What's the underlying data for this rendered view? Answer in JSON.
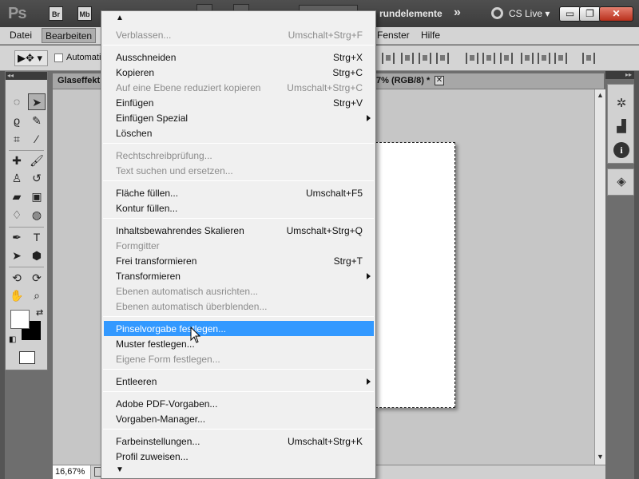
{
  "app": {
    "logo": "Ps",
    "bridge_button": "Br",
    "minibridge_button": "Mb",
    "workspace_label": "rundelemente",
    "workspace_more": "»",
    "cs_live_label": "CS Live",
    "minimize_label": "▭",
    "restore_label": "❐",
    "close_label": "✕"
  },
  "menubar": {
    "items": [
      "Datei",
      "Bearbeiten",
      "Fenster",
      "Hilfe"
    ]
  },
  "options_bar": {
    "tool_label": "▶✥ ▾",
    "auto_select_label": "Automatis"
  },
  "document": {
    "tab_left_title": "Glaseffekt",
    "tab_right_title": "7% (RGB/8) *",
    "tab_close_label": "✕",
    "zoom_value": "16,67%"
  },
  "edit_menu": {
    "items": [
      {
        "label": "Verblassen...",
        "shortcut": "Umschalt+Strg+F",
        "enabled": false
      },
      {
        "label": "Ausschneiden",
        "shortcut": "Strg+X",
        "enabled": true
      },
      {
        "label": "Kopieren",
        "shortcut": "Strg+C",
        "enabled": true
      },
      {
        "label": "Auf eine Ebene reduziert kopieren",
        "shortcut": "Umschalt+Strg+C",
        "enabled": false
      },
      {
        "label": "Einfügen",
        "shortcut": "Strg+V",
        "enabled": true
      },
      {
        "label": "Einfügen Spezial",
        "shortcut": "",
        "enabled": true
      },
      {
        "label": "Löschen",
        "shortcut": "",
        "enabled": true
      },
      {
        "label": "Rechtschreibprüfung...",
        "shortcut": "",
        "enabled": false
      },
      {
        "label": "Text suchen und ersetzen...",
        "shortcut": "",
        "enabled": false
      },
      {
        "label": "Fläche füllen...",
        "shortcut": "Umschalt+F5",
        "enabled": true
      },
      {
        "label": "Kontur füllen...",
        "shortcut": "",
        "enabled": true
      },
      {
        "label": "Inhaltsbewahrendes Skalieren",
        "shortcut": "Umschalt+Strg+Q",
        "enabled": true
      },
      {
        "label": "Formgitter",
        "shortcut": "",
        "enabled": false
      },
      {
        "label": "Frei transformieren",
        "shortcut": "Strg+T",
        "enabled": true
      },
      {
        "label": "Transformieren",
        "shortcut": "",
        "enabled": true
      },
      {
        "label": "Ebenen automatisch ausrichten...",
        "shortcut": "",
        "enabled": false
      },
      {
        "label": "Ebenen automatisch überblenden...",
        "shortcut": "",
        "enabled": false
      },
      {
        "label": "Pinselvorgabe festlegen...",
        "shortcut": "",
        "enabled": true,
        "highlighted": true
      },
      {
        "label": "Muster festlegen...",
        "shortcut": "",
        "enabled": true
      },
      {
        "label": "Eigene Form festlegen...",
        "shortcut": "",
        "enabled": false
      },
      {
        "label": "Entleeren",
        "shortcut": "",
        "enabled": true
      },
      {
        "label": "Adobe PDF-Vorgaben...",
        "shortcut": "",
        "enabled": true
      },
      {
        "label": "Vorgaben-Manager...",
        "shortcut": "",
        "enabled": true
      },
      {
        "label": "Farbeinstellungen...",
        "shortcut": "Umschalt+Strg+K",
        "enabled": true
      },
      {
        "label": "Profil zuweisen...",
        "shortcut": "",
        "enabled": true
      }
    ]
  },
  "colors": {
    "highlight": "#3399ff",
    "menu_background": "#f0f0f0",
    "disabled_text": "#8c8c8c",
    "app_bar": "#444444"
  },
  "icons": [
    "move-tool-icon",
    "marquee-tool-icon",
    "lasso-tool-icon",
    "crop-tool-icon",
    "brush-tool-icon",
    "stamp-tool-icon",
    "eraser-tool-icon",
    "gradient-tool-icon",
    "pen-tool-icon",
    "type-tool-icon",
    "hand-tool-icon",
    "zoom-tool-icon",
    "color-panel-icon",
    "histogram-icon",
    "info-icon",
    "layers-icon"
  ]
}
